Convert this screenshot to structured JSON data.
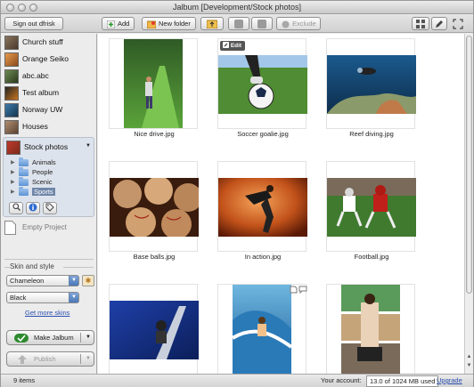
{
  "window": {
    "title": "Jalbum [Development/Stock photos]"
  },
  "toolbar": {
    "sign_out": "Sign out dfrisk",
    "add": "Add",
    "new_folder": "New folder",
    "exclude": "Exclude"
  },
  "sidebar": {
    "albums": [
      {
        "label": "Church stuff",
        "thumb": "#6f5d4a"
      },
      {
        "label": "Orange Seiko",
        "thumb": "#c8773a"
      },
      {
        "label": "abc.abc",
        "thumb": "#4c6a3a"
      },
      {
        "label": "Test album",
        "thumb": "#c47a2a"
      },
      {
        "label": "Norway UW",
        "thumb": "#2e5f84"
      },
      {
        "label": "Houses",
        "thumb": "#8a6a52"
      }
    ],
    "stock": {
      "label": "Stock photos",
      "folders": [
        "Animals",
        "People",
        "Scenic",
        "Sports"
      ],
      "selected": "Sports"
    },
    "empty_project": "Empty Project",
    "skin_section": "Skin and style",
    "skin": "Chameleon",
    "style": "Black",
    "more_skins": "Get more skins",
    "make_album": "Make Jalbum",
    "publish": "Publish"
  },
  "main": {
    "edit_label": "Edit",
    "photos": [
      {
        "caption": "Nice drive.jpg"
      },
      {
        "caption": "Soccer goalie.jpg"
      },
      {
        "caption": "Reef diving.jpg"
      },
      {
        "caption": "Base balls.jpg"
      },
      {
        "caption": "In action.jpg"
      },
      {
        "caption": "Football.jpg"
      },
      {
        "caption": ""
      },
      {
        "caption": ""
      },
      {
        "caption": ""
      }
    ]
  },
  "status": {
    "items": "9 items",
    "account_label": "Your account:",
    "quota": "13.0 of 1024 MB used",
    "upgrade": "Upgrade"
  },
  "colors": {
    "accent": "#2a4fb0",
    "selection": "#6f86a9"
  }
}
